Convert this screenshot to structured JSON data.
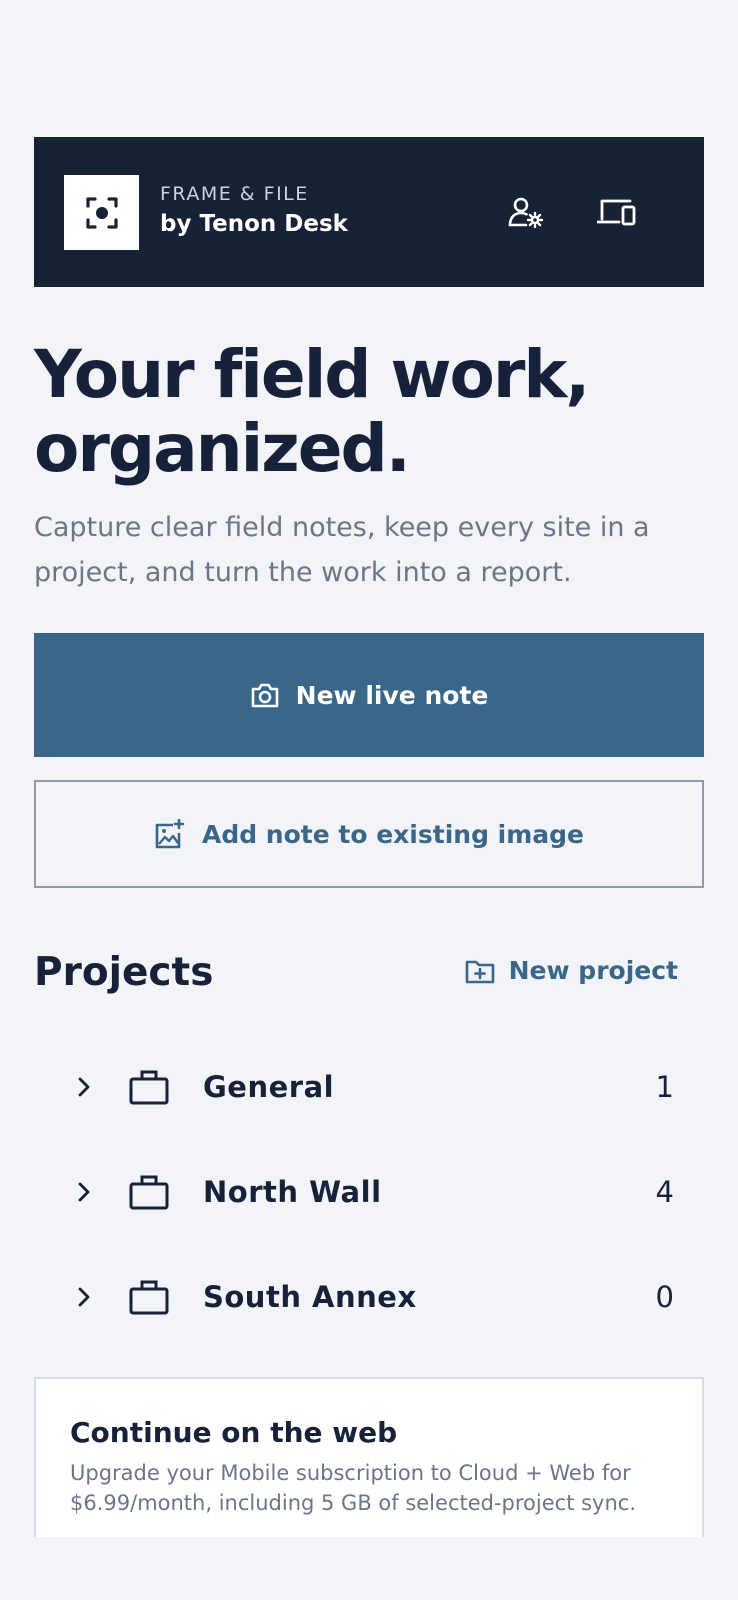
{
  "header": {
    "brand_top": "FRAME & FILE",
    "brand_bottom": "by Tenon Desk",
    "icons": [
      "focus-camera-icon",
      "user-settings-icon",
      "devices-icon"
    ]
  },
  "hero": {
    "title": "Your field work, organized.",
    "subtitle": "Capture clear field notes, keep every site in a project, and turn the work into a report."
  },
  "actions": {
    "new_live_note": "New live note",
    "add_note_existing": "Add note to existing image"
  },
  "projects": {
    "title": "Projects",
    "new_project": "New project",
    "items": [
      {
        "name": "General",
        "count": "1"
      },
      {
        "name": "North Wall",
        "count": "4"
      },
      {
        "name": "South Annex",
        "count": "0"
      }
    ]
  },
  "web_card": {
    "title": "Continue on the web",
    "text": "Upgrade your Mobile subscription to Cloud + Web for $6.99/month, including 5 GB of selected-project sync."
  },
  "colors": {
    "header_bg": "#182235",
    "primary": "#3a6689",
    "page_bg": "#f2f4f8",
    "text_dark": "#17223a",
    "text_muted": "#6b7689"
  }
}
